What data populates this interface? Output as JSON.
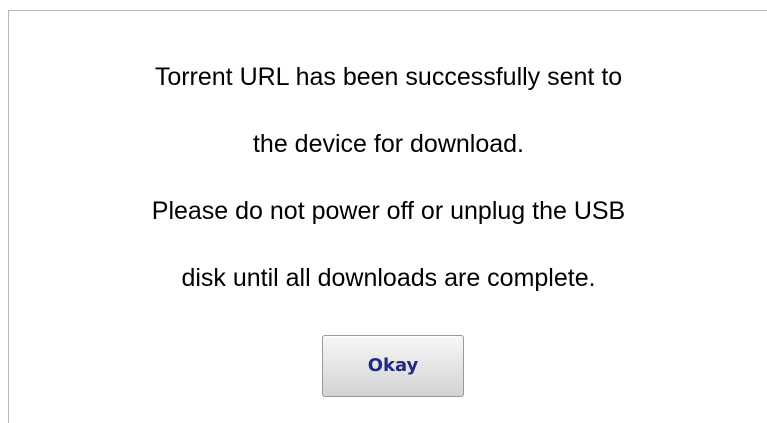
{
  "dialog": {
    "message_lines": [
      "Torrent URL has been successfully sent to",
      "the device for download.",
      "Please do not power off or unplug the USB",
      "disk until all downloads are complete."
    ],
    "okay_label": "Okay"
  }
}
